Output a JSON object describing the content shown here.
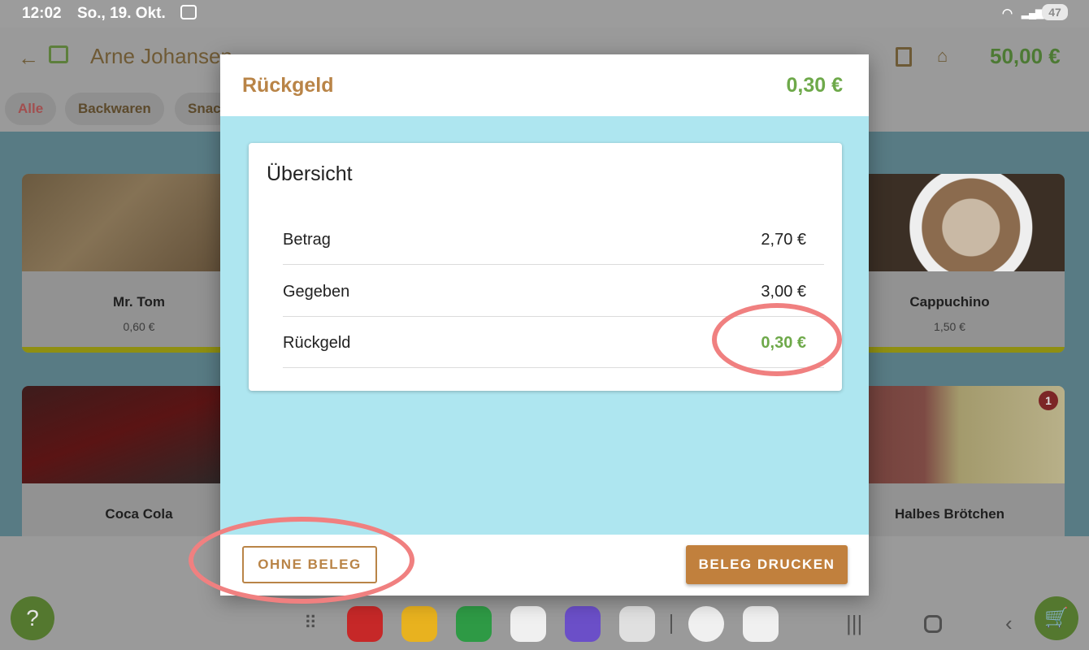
{
  "status_bar": {
    "time": "12:02",
    "date": "So., 19. Okt.",
    "battery": "47"
  },
  "app_bar": {
    "customer_name": "Arne Johansen",
    "cart_total": "50,00 €"
  },
  "categories": [
    {
      "label": "Alle",
      "active": true
    },
    {
      "label": "Backwaren",
      "active": false
    },
    {
      "label": "Snac",
      "active": false
    }
  ],
  "products": [
    {
      "name": "Mr. Tom",
      "price": "0,60 €"
    },
    {
      "name": "Cappuchino",
      "price": "1,50 €"
    },
    {
      "name": "Coca Cola",
      "price": ""
    },
    {
      "name": "Halbes Brötchen",
      "price": "",
      "badge": "1"
    }
  ],
  "dialog": {
    "title": "Rückgeld",
    "header_amount": "0,30 €",
    "overview_title": "Übersicht",
    "rows": [
      {
        "label": "Betrag",
        "value": "2,70 €"
      },
      {
        "label": "Gegeben",
        "value": "3,00 €"
      },
      {
        "label": "Rückgeld",
        "value": "0,30 €"
      }
    ],
    "button_no_receipt": "OHNE BELEG",
    "button_print_receipt": "BELEG DRUCKEN"
  },
  "fab": {
    "help": "?"
  },
  "colors": {
    "accent": "#b98447",
    "positive": "#6ea94a",
    "annotation": "#f08080",
    "overlay_blue": "#aee6f0"
  }
}
